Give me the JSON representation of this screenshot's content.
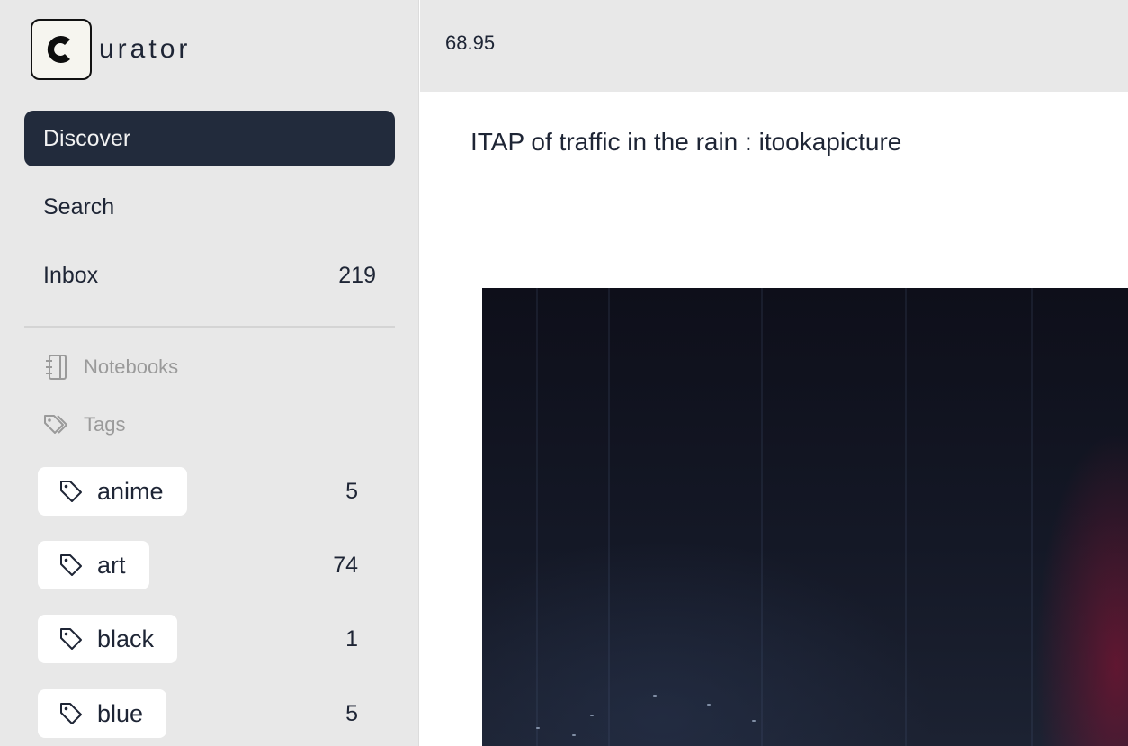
{
  "app": {
    "logo_letter": "c",
    "logo_rest": "urator"
  },
  "nav": [
    {
      "label": "Discover",
      "count": "",
      "active": true
    },
    {
      "label": "Search",
      "count": ""
    },
    {
      "label": "Inbox",
      "count": "219"
    }
  ],
  "sections": {
    "notebooks": {
      "label": "Notebooks",
      "icon": "notebook-icon"
    },
    "tags": {
      "label": "Tags",
      "icon": "tags-icon"
    }
  },
  "tags": [
    {
      "label": "anime",
      "count": "5",
      "icon": "tag-icon"
    },
    {
      "label": "art",
      "count": "74",
      "icon": "tag-icon"
    },
    {
      "label": "black",
      "count": "1",
      "icon": "tag-icon"
    },
    {
      "label": "blue",
      "count": "5",
      "icon": "tag-icon"
    }
  ],
  "topbar": {
    "value": "68.95"
  },
  "post": {
    "title": "ITAP of traffic in the rain : itookapicture"
  },
  "colors": {
    "sidebar_bg": "#e8e8e8",
    "active_nav_bg": "#222b3c",
    "text": "#1e2535",
    "muted": "#9a9a9a"
  }
}
